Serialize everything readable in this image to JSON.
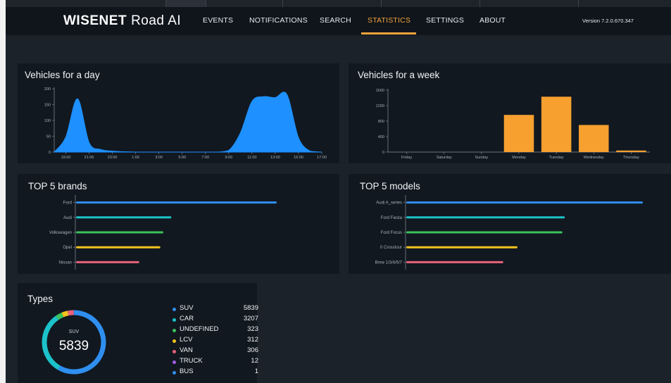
{
  "app": {
    "logo_brand": "WISENET",
    "logo_product": "Road AI",
    "version": "Version 7.2.0.670.347"
  },
  "nav": {
    "items": [
      {
        "label": "EVENTS"
      },
      {
        "label": "NOTIFICATIONS"
      },
      {
        "label": "SEARCH"
      },
      {
        "label": "STATISTICS",
        "active": true
      },
      {
        "label": "SETTINGS"
      },
      {
        "label": "ABOUT"
      }
    ]
  },
  "colors": {
    "accent": "#f2a33a",
    "day_area": "#1e90ff",
    "week_bar": "#f7a030",
    "blue": "#2f8ff0",
    "teal": "#1cc2c9",
    "green": "#3cc25a",
    "yellow": "#f3c21c",
    "pink": "#e8627a",
    "purple": "#a35ce6"
  },
  "panels": {
    "day": {
      "title": "Vehicles for a day"
    },
    "week": {
      "title": "Vehicles for a week"
    },
    "brands": {
      "title": "TOP 5 brands"
    },
    "models": {
      "title": "TOP 5 models"
    },
    "types": {
      "title": "Types"
    }
  },
  "chart_data": [
    {
      "id": "day",
      "type": "area",
      "title": "Vehicles for a day",
      "x": [
        "18:00",
        "19:00",
        "20:00",
        "21:00",
        "22:00",
        "23:00",
        "0:00",
        "1:00",
        "2:00",
        "3:00",
        "4:00",
        "5:00",
        "6:00",
        "7:00",
        "8:00",
        "9:00",
        "10:00",
        "11:00",
        "12:00",
        "13:00",
        "14:00",
        "15:00",
        "16:00",
        "17:00"
      ],
      "values": [
        0,
        48,
        168,
        30,
        8,
        3,
        1,
        0,
        0,
        0,
        0,
        0,
        0,
        0,
        0,
        5,
        60,
        160,
        175,
        172,
        182,
        45,
        3,
        0
      ],
      "xticks": [
        "19:00",
        "21:00",
        "23:00",
        "1:00",
        "3:00",
        "5:00",
        "7:00",
        "9:00",
        "11:00",
        "13:00",
        "15:00",
        "17:00"
      ],
      "yticks": [
        0,
        50,
        100,
        150,
        200
      ],
      "ylim": [
        0,
        200
      ]
    },
    {
      "id": "week",
      "type": "bar",
      "title": "Vehicles for a week",
      "categories": [
        "Friday",
        "Saturday",
        "Sunday",
        "Monday",
        "Tuesday",
        "Wednesday",
        "Thursday"
      ],
      "values": [
        0,
        0,
        0,
        960,
        1430,
        700,
        40
      ],
      "yticks": [
        0,
        400,
        800,
        1200,
        1600
      ],
      "ylim": [
        0,
        1600
      ]
    },
    {
      "id": "brands",
      "type": "bar",
      "orientation": "horizontal",
      "title": "TOP 5 brands",
      "categories": [
        "Ford",
        "Audi",
        "Volkswagen",
        "Opel",
        "Nissan"
      ],
      "values": [
        100,
        47.5,
        43.5,
        42,
        31.5
      ],
      "colors": [
        "#2f8ff0",
        "#1cc2c9",
        "#3cc25a",
        "#f3c21c",
        "#e8627a"
      ]
    },
    {
      "id": "models",
      "type": "bar",
      "orientation": "horizontal",
      "title": "TOP 5 models",
      "categories": [
        "Audi A_series",
        "Ford Fiesta",
        "Ford Focus",
        "0 Crosstour",
        "Bmw 1/3/4/5/7"
      ],
      "values": [
        100,
        67,
        66,
        47,
        41
      ],
      "colors": [
        "#2f8ff0",
        "#1cc2c9",
        "#3cc25a",
        "#f3c21c",
        "#e8627a"
      ]
    },
    {
      "id": "types",
      "type": "pie",
      "title": "Types",
      "center_label": "SUV",
      "center_value": "5839",
      "categories": [
        "SUV",
        "CAR",
        "UNDEFINED",
        "LCV",
        "VAN",
        "TRUCK",
        "BUS"
      ],
      "values": [
        5839,
        3207,
        323,
        312,
        306,
        12,
        1
      ],
      "colors": [
        "#2f8ff0",
        "#1cc2c9",
        "#3cc25a",
        "#f3c21c",
        "#e8627a",
        "#a35ce6",
        "#2f8ff0"
      ]
    }
  ]
}
